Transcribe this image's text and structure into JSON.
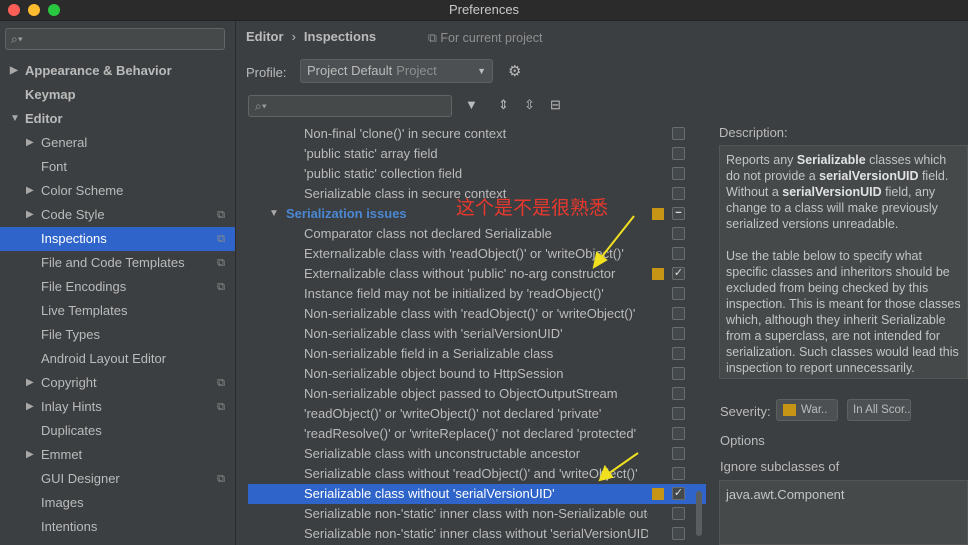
{
  "window": {
    "title": "Preferences"
  },
  "colors": {
    "selection": "#2f65ca",
    "warning": "#c79516",
    "group": "#4a88d4",
    "annotation": "#e8382e",
    "arrow": "#f0e020"
  },
  "sidebar": {
    "search_placeholder": "",
    "items": [
      {
        "label": "Appearance & Behavior",
        "level": 0,
        "arrow": "▶",
        "bold": true
      },
      {
        "label": "Keymap",
        "level": 0,
        "arrow": "",
        "bold": true
      },
      {
        "label": "Editor",
        "level": 0,
        "arrow": "▼",
        "bold": true
      },
      {
        "label": "General",
        "level": 1,
        "arrow": "▶"
      },
      {
        "label": "Font",
        "level": 1,
        "arrow": ""
      },
      {
        "label": "Color Scheme",
        "level": 1,
        "arrow": "▶"
      },
      {
        "label": "Code Style",
        "level": 1,
        "arrow": "▶",
        "copy": true
      },
      {
        "label": "Inspections",
        "level": 1,
        "arrow": "",
        "copy": true,
        "selected": true
      },
      {
        "label": "File and Code Templates",
        "level": 1,
        "arrow": "",
        "copy": true
      },
      {
        "label": "File Encodings",
        "level": 1,
        "arrow": "",
        "copy": true
      },
      {
        "label": "Live Templates",
        "level": 1,
        "arrow": ""
      },
      {
        "label": "File Types",
        "level": 1,
        "arrow": ""
      },
      {
        "label": "Android Layout Editor",
        "level": 1,
        "arrow": ""
      },
      {
        "label": "Copyright",
        "level": 1,
        "arrow": "▶",
        "copy": true
      },
      {
        "label": "Inlay Hints",
        "level": 1,
        "arrow": "▶",
        "copy": true
      },
      {
        "label": "Duplicates",
        "level": 1,
        "arrow": ""
      },
      {
        "label": "Emmet",
        "level": 1,
        "arrow": "▶"
      },
      {
        "label": "GUI Designer",
        "level": 1,
        "arrow": "",
        "copy": true
      },
      {
        "label": "Images",
        "level": 1,
        "arrow": ""
      },
      {
        "label": "Intentions",
        "level": 1,
        "arrow": ""
      }
    ]
  },
  "header": {
    "breadcrumb_parent": "Editor",
    "breadcrumb_sep": "›",
    "breadcrumb_current": "Inspections",
    "for_project": "For current project"
  },
  "profile": {
    "label": "Profile:",
    "value": "Project Default",
    "sub": "Project"
  },
  "inspections": [
    {
      "text": "Non-final 'clone()' in secure context"
    },
    {
      "text": "'public static' array field"
    },
    {
      "text": "'public static' collection field"
    },
    {
      "text": "Serializable class in secure context"
    },
    {
      "text": "Serialization issues",
      "group": true,
      "sev": true,
      "check": "−"
    },
    {
      "text": "Comparator class not declared Serializable"
    },
    {
      "text": "Externalizable class with 'readObject()' or 'writeObject()'"
    },
    {
      "text": "Externalizable class without 'public' no-arg constructor",
      "sev": true,
      "check": "✓"
    },
    {
      "text": "Instance field may not be initialized by 'readObject()'"
    },
    {
      "text": "Non-serializable class with 'readObject()' or 'writeObject()'"
    },
    {
      "text": "Non-serializable class with 'serialVersionUID'"
    },
    {
      "text": "Non-serializable field in a Serializable class"
    },
    {
      "text": "Non-serializable object bound to HttpSession"
    },
    {
      "text": "Non-serializable object passed to ObjectOutputStream"
    },
    {
      "text": "'readObject()' or 'writeObject()' not declared 'private'"
    },
    {
      "text": "'readResolve()' or 'writeReplace()' not declared 'protected'"
    },
    {
      "text": "Serializable class with unconstructable ancestor"
    },
    {
      "text": "Serializable class without 'readObject()' and 'writeObject()'"
    },
    {
      "text": "Serializable class without 'serialVersionUID'",
      "selected": true,
      "sev": true,
      "check": "✓"
    },
    {
      "text": "Serializable non-'static' inner class with non-Serializable outer"
    },
    {
      "text": "Serializable non-'static' inner class without 'serialVersionUID'"
    }
  ],
  "annotation": "这个是不是很熟悉",
  "description": {
    "label": "Description:",
    "p1_a": "Reports any ",
    "p1_b": "Serializable",
    "p1_c": " classes which do not provide a ",
    "p1_d": "serialVersionUID",
    "p1_e": " field. Without a ",
    "p1_f": "serialVersionUID",
    "p1_g": " field, any change to a class will make previously serialized versions unreadable.",
    "p2": "Use the table below to specify what specific classes and inheritors should be excluded from being checked by this inspection. This is meant for those classes which, although they inherit Serializable from a superclass, are not intended for serialization. Such classes would lead this inspection to report unnecessarily."
  },
  "severity": {
    "label": "Severity:",
    "value": "War..",
    "scope": "In All Scor.."
  },
  "options": {
    "label": "Options",
    "ignore_label": "Ignore subclasses of",
    "ignore_value": "java.awt.Component"
  }
}
